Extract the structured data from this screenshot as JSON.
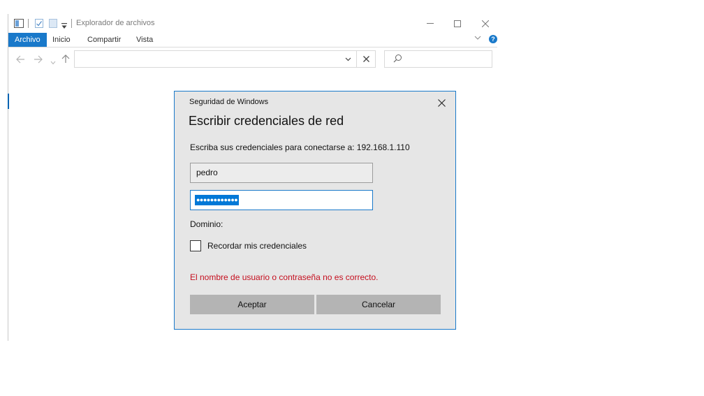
{
  "explorer": {
    "title": "Explorador de archivos",
    "ribbon_tabs": [
      {
        "label": "Archivo",
        "active": true
      },
      {
        "label": "Inicio",
        "active": false
      },
      {
        "label": "Compartir",
        "active": false
      },
      {
        "label": "Vista",
        "active": false
      }
    ],
    "help_label": "?",
    "address_value": "",
    "search_value": ""
  },
  "dialog": {
    "caption": "Seguridad de Windows",
    "title": "Escribir credenciales de red",
    "instruction": "Escriba sus credenciales para conectarse a: 192.168.1.110",
    "username_value": "pedro",
    "password_mask": "●●●●●●●●●●●●",
    "domain_label": "Dominio:",
    "remember_label": "Recordar mis credenciales",
    "remember_checked": false,
    "error_message": "El nombre de usuario o contraseña no es correcto.",
    "ok_label": "Aceptar",
    "cancel_label": "Cancelar"
  },
  "colors": {
    "accent": "#1979ca",
    "selection": "#0078d7",
    "error": "#c50f1f",
    "dialog_bg": "#e6e6e6",
    "button_bg": "#b4b4b4"
  }
}
